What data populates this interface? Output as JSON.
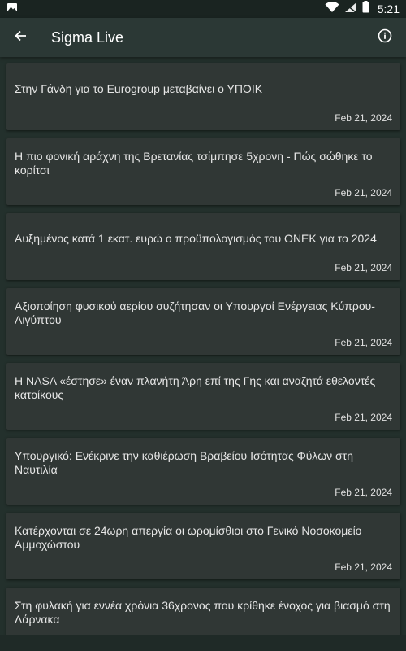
{
  "status_bar": {
    "time": "5:21",
    "icons": [
      "image-icon",
      "wifi-icon",
      "signal-icon",
      "battery-icon"
    ]
  },
  "app_bar": {
    "title": "Sigma Live",
    "icons": [
      "back-arrow-icon",
      "info-icon"
    ]
  },
  "articles": [
    {
      "title": "Στην Γάνδη για το Eurogroup μεταβαίνει ο ΥΠΟΙΚ",
      "date": "Feb 21, 2024"
    },
    {
      "title": "Η πιο φονική αράχνη της Βρετανίας τσίμπησε 5χρονη - Πώς σώθηκε το κορίτσι",
      "date": "Feb 21, 2024"
    },
    {
      "title": "Αυξημένος κατά 1 εκατ. ευρώ ο προϋπολογισμός του ΟΝΕΚ για το 2024",
      "date": "Feb 21, 2024"
    },
    {
      "title": "Αξιοποίηση φυσικού αερίου συζήτησαν οι Υπουργοί Ενέργειας Κύπρου-Αιγύπτου",
      "date": "Feb 21, 2024"
    },
    {
      "title": "Η NASA «έστησε» έναν πλανήτη Άρη επί της Γης και αναζητά εθελοντές κατοίκους",
      "date": "Feb 21, 2024"
    },
    {
      "title": "Υπουργικό: Ενέκρινε την καθιέρωση Βραβείου Ισότητας Φύλων στη Ναυτιλία",
      "date": "Feb 21, 2024"
    },
    {
      "title": "Κατέρχονται σε 24ωρη απεργία οι ωρομίσθιοι στο Γενικό Νοσοκομείο Αμμοχώστου",
      "date": "Feb 21, 2024"
    },
    {
      "title": "Στη φυλακή για εννέα χρόνια 36χρονος που κρίθηκε ένοχος για βιασμό στη Λάρνακα",
      "date": ""
    }
  ],
  "colors": {
    "background": "#23302c",
    "app_bar": "#2b3835",
    "card": "#303735",
    "text": "#e6e6e6"
  }
}
